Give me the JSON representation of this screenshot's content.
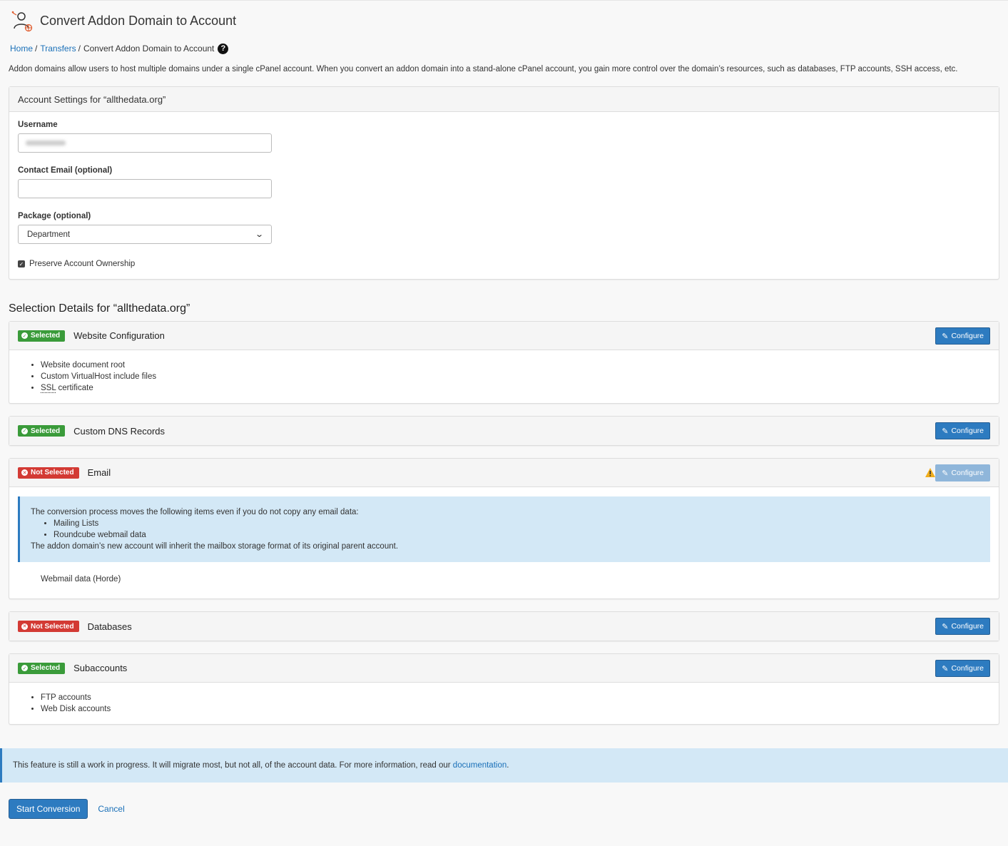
{
  "header": {
    "title": "Convert Addon Domain to Account",
    "icon": "addon-convert-icon"
  },
  "breadcrumb": {
    "items": [
      "Home",
      "Transfers",
      "Convert Addon Domain to Account"
    ],
    "separator": "/"
  },
  "intro_text": "Addon domains allow users to host multiple domains under a single cPanel account. When you convert an addon domain into a stand-alone cPanel account, you gain more control over the domain’s resources, such as databases, FTP accounts, SSH access, etc.",
  "account_settings": {
    "heading": "Account Settings for “allthedata.org”",
    "username_label": "Username",
    "username_value": "",
    "contact_email_label": "Contact Email (optional)",
    "contact_email_value": "",
    "package_label": "Package (optional)",
    "package_selected": "Department",
    "preserve_ownership_label": "Preserve Account Ownership",
    "preserve_ownership_checked": true
  },
  "selection": {
    "title": "Selection Details for “allthedata.org”",
    "configure_label": "Configure",
    "sections": [
      {
        "status": "Selected",
        "title": "Website Configuration",
        "items": [
          "Website document root",
          "Custom VirtualHost include files",
          "SSL",
          "certificate"
        ]
      },
      {
        "status": "Selected",
        "title": "Custom DNS Records",
        "items": []
      },
      {
        "status": "Not Selected",
        "title": "Email",
        "info_intro": "The conversion process moves the following items even if you do not copy any email data:",
        "info_items": [
          "Mailing Lists",
          "Roundcube webmail data"
        ],
        "info_outro": "The addon domain’s new account will inherit the mailbox storage format of its original parent account.",
        "extra_line": "Webmail data (Horde)"
      },
      {
        "status": "Not Selected",
        "title": "Databases",
        "items": []
      },
      {
        "status": "Selected",
        "title": "Subaccounts",
        "items": [
          "FTP accounts",
          "Web Disk accounts"
        ]
      }
    ]
  },
  "bottom_notice": {
    "text": "This feature is still a work in progress. It will migrate most, but not all, of the account data. For more information, read our",
    "link": "documentation",
    "end": "."
  },
  "actions": {
    "start_label": "Start Conversion",
    "cancel_label": "Cancel"
  },
  "colors": {
    "accent": "#2d7bc0",
    "selected": "#3a9b3a",
    "not_selected": "#d33a34",
    "info_bg": "#d3e8f6",
    "warning": "#f0ad1c"
  }
}
